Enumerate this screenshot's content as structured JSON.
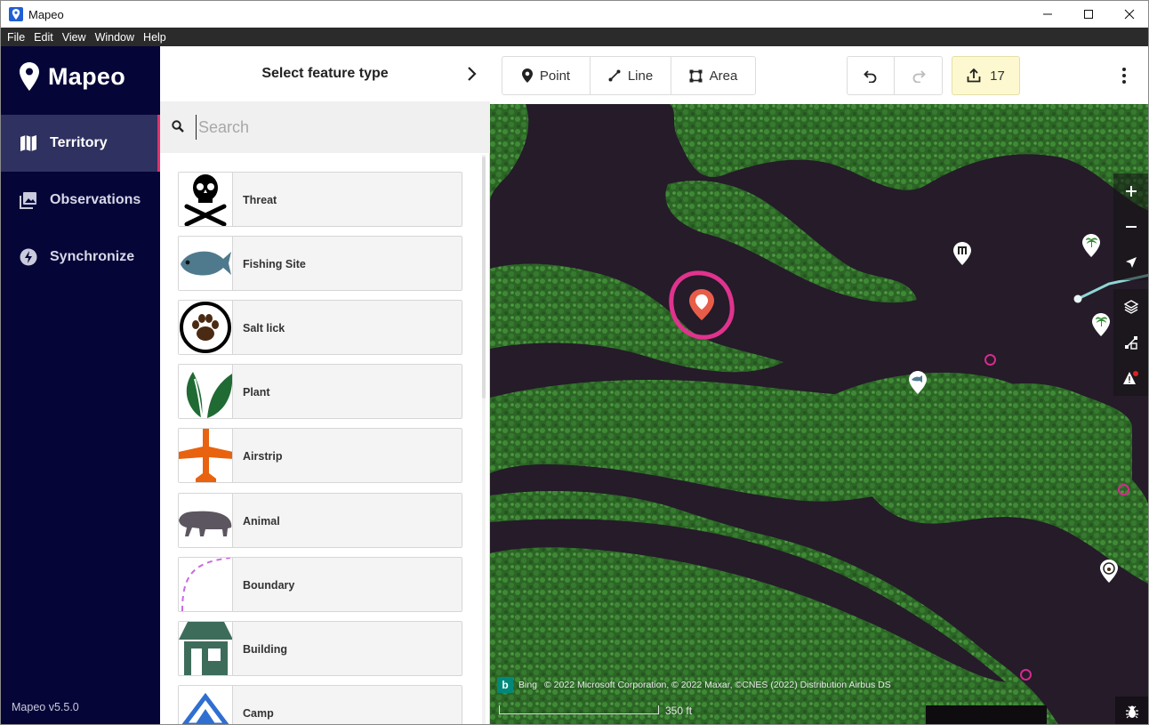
{
  "window": {
    "title": "Mapeo"
  },
  "menu": [
    "File",
    "Edit",
    "View",
    "Window",
    "Help"
  ],
  "sidebar": {
    "brand": "Mapeo",
    "items": [
      {
        "label": "Territory",
        "icon": "map-icon",
        "active": true
      },
      {
        "label": "Observations",
        "icon": "photo-library-icon",
        "active": false
      },
      {
        "label": "Synchronize",
        "icon": "lightning-icon",
        "active": false
      }
    ],
    "version": "Mapeo v5.5.0"
  },
  "panel": {
    "title": "Select feature type",
    "search_placeholder": "Search",
    "search_value": "",
    "presets": [
      {
        "label": "Threat",
        "icon": "skull-crossbones-icon"
      },
      {
        "label": "Fishing Site",
        "icon": "fish-icon"
      },
      {
        "label": "Salt lick",
        "icon": "paw-icon"
      },
      {
        "label": "Plant",
        "icon": "leaf-icon"
      },
      {
        "label": "Airstrip",
        "icon": "airplane-icon"
      },
      {
        "label": "Animal",
        "icon": "tapir-icon"
      },
      {
        "label": "Boundary",
        "icon": "dashed-line-icon"
      },
      {
        "label": "Building",
        "icon": "building-icon"
      },
      {
        "label": "Camp",
        "icon": "tent-icon"
      }
    ]
  },
  "toolbar": {
    "point_label": "Point",
    "line_label": "Line",
    "area_label": "Area",
    "sync_count": "17"
  },
  "map": {
    "attribution_brand": "Bing",
    "attribution": "© 2022 Microsoft Corporation, © 2022 Maxar, ©CNES (2022) Distribution Airbus DS",
    "scale_label": "350 ft"
  },
  "colors": {
    "sidebar_bg": "#050538",
    "accent_pink": "#e0336e",
    "sync_bg": "#fdf8cf",
    "map_water": "#251b29",
    "forest": "#2f6f2a"
  }
}
